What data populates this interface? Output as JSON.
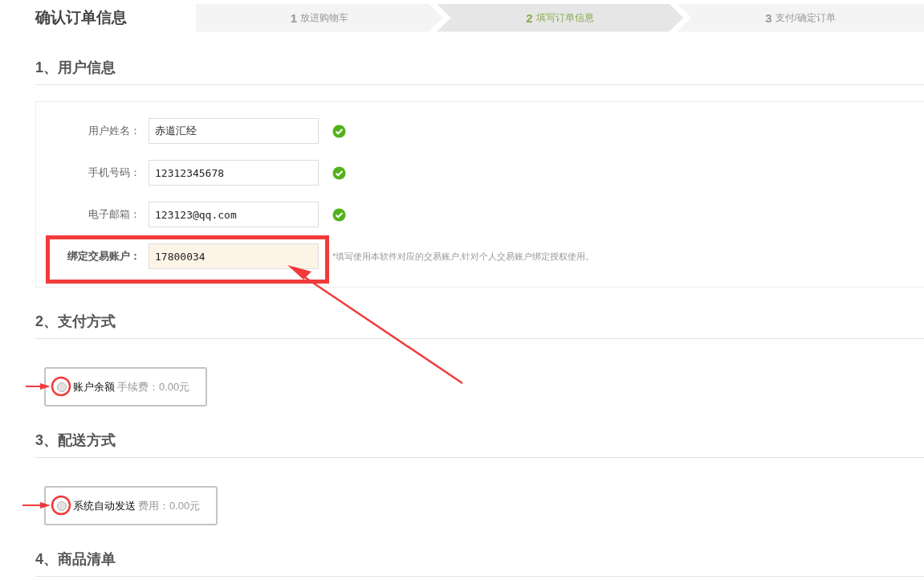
{
  "page_title": "确认订单信息",
  "steps": [
    {
      "number": "1",
      "label": "放进购物车",
      "selected": false
    },
    {
      "number": "2",
      "label": "填写订单信息",
      "selected": true
    },
    {
      "number": "3",
      "label": "支付/确定订单",
      "selected": false
    }
  ],
  "user_info": {
    "heading": "1、用户信息",
    "fields": [
      {
        "label": "用户姓名：",
        "value": "赤道汇经",
        "valid": true,
        "focused": false
      },
      {
        "label": "手机号码：",
        "value": "12312345678",
        "valid": true,
        "focused": false
      },
      {
        "label": "电子邮箱：",
        "value": "123123@qq.com",
        "valid": true,
        "focused": false
      },
      {
        "label": "绑定交易账户：",
        "value": "17800034",
        "valid": false,
        "focused": true,
        "hint": "*填写使用本软件对应的交易账户,针对个人交易账户绑定授权使用。"
      }
    ]
  },
  "payment": {
    "heading": "2、支付方式",
    "options": [
      {
        "name": "账户余额",
        "fee": "手续费：0.00元",
        "selected": false
      }
    ]
  },
  "delivery": {
    "heading": "3、配送方式",
    "options": [
      {
        "name": "系统自动发送",
        "fee": "费用：0.00元",
        "selected": false
      }
    ]
  },
  "goods": {
    "heading": "4、商品清单"
  }
}
